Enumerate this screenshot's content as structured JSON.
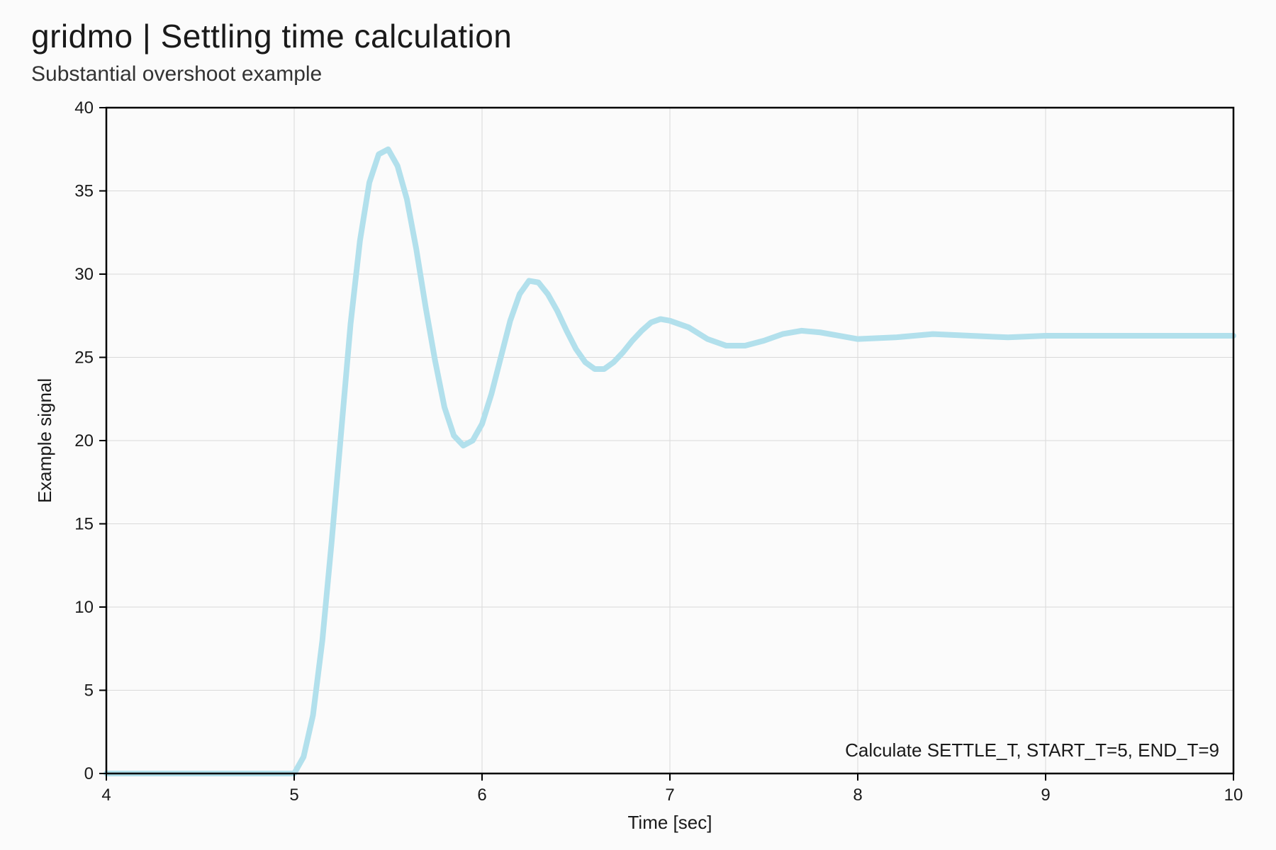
{
  "header": {
    "title": "gridmo | Settling time calculation",
    "subtitle": "Substantial overshoot example"
  },
  "chart_data": {
    "type": "line",
    "title": "",
    "xlabel": "Time [sec]",
    "ylabel": "Example signal",
    "xlim": [
      4,
      10
    ],
    "ylim": [
      0,
      40
    ],
    "xticks": [
      4,
      5,
      6,
      7,
      8,
      9,
      10
    ],
    "yticks": [
      0,
      5,
      10,
      15,
      20,
      25,
      30,
      35,
      40
    ],
    "grid": true,
    "annotation": "Calculate SETTLE_T, START_T=5, END_T=9",
    "series": [
      {
        "name": "Example signal",
        "color": "#b2e0ec",
        "x": [
          4.0,
          4.5,
          4.9,
          5.0,
          5.05,
          5.1,
          5.15,
          5.2,
          5.25,
          5.3,
          5.35,
          5.4,
          5.45,
          5.5,
          5.55,
          5.6,
          5.65,
          5.7,
          5.75,
          5.8,
          5.85,
          5.9,
          5.95,
          6.0,
          6.05,
          6.1,
          6.15,
          6.2,
          6.25,
          6.3,
          6.35,
          6.4,
          6.45,
          6.5,
          6.55,
          6.6,
          6.65,
          6.7,
          6.75,
          6.8,
          6.85,
          6.9,
          6.95,
          7.0,
          7.1,
          7.2,
          7.3,
          7.4,
          7.5,
          7.6,
          7.7,
          7.8,
          7.9,
          8.0,
          8.2,
          8.4,
          8.6,
          8.8,
          9.0,
          9.5,
          10.0
        ],
        "y": [
          0.0,
          0.0,
          0.0,
          0.0,
          1.0,
          3.5,
          8.0,
          14.0,
          20.5,
          27.0,
          32.0,
          35.5,
          37.2,
          37.5,
          36.5,
          34.5,
          31.5,
          28.0,
          24.8,
          22.0,
          20.3,
          19.7,
          20.0,
          21.0,
          22.8,
          25.0,
          27.2,
          28.8,
          29.6,
          29.5,
          28.8,
          27.8,
          26.6,
          25.5,
          24.7,
          24.3,
          24.3,
          24.7,
          25.3,
          26.0,
          26.6,
          27.1,
          27.3,
          27.2,
          26.8,
          26.1,
          25.7,
          25.7,
          26.0,
          26.4,
          26.6,
          26.5,
          26.3,
          26.1,
          26.2,
          26.4,
          26.3,
          26.2,
          26.3,
          26.3,
          26.3
        ]
      }
    ]
  }
}
